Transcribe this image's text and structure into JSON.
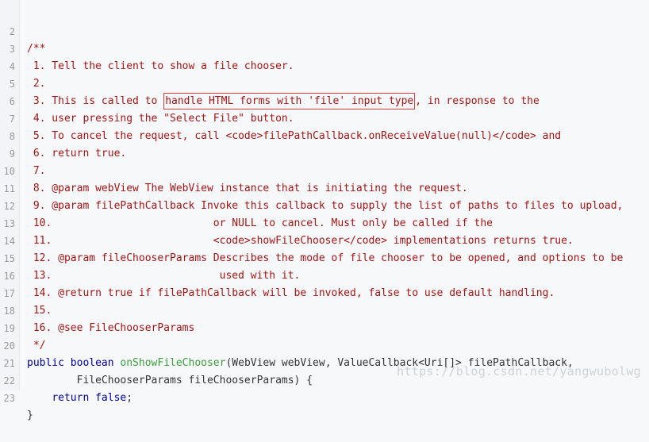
{
  "code_lines": [
    {
      "num": "2",
      "text": "/**"
    },
    {
      "num": "3",
      "text": " 1. Tell the client to show a file chooser."
    },
    {
      "num": "4",
      "text": " 2."
    },
    {
      "num": "5",
      "pre": " 3. This is called to ",
      "highlight": "handle HTML forms with 'file' input type",
      "post": ", in response to the"
    },
    {
      "num": "6",
      "text": " 4. user pressing the \"Select File\" button."
    },
    {
      "num": "7",
      "text": " 5. To cancel the request, call <code>filePathCallback.onReceiveValue(null)</code> and"
    },
    {
      "num": "8",
      "text": " 6. return true."
    },
    {
      "num": "9",
      "text": " 7."
    },
    {
      "num": "10",
      "text": " 8. @param webView The WebView instance that is initiating the request."
    },
    {
      "num": "11",
      "text": " 9. @param filePathCallback Invoke this callback to supply the list of paths to files to upload,"
    },
    {
      "num": "12",
      "text": " 10.                          or NULL to cancel. Must only be called if the"
    },
    {
      "num": "13",
      "text": " 11.                          <code>showFileChooser</code> implementations returns true."
    },
    {
      "num": "14",
      "text": " 12. @param fileChooserParams Describes the mode of file chooser to be opened, and options to be"
    },
    {
      "num": "15",
      "text": " 13.                           used with it."
    },
    {
      "num": "16",
      "text": " 14. @return true if filePathCallback will be invoked, false to use default handling."
    },
    {
      "num": "17",
      "text": " 15."
    },
    {
      "num": "18",
      "text": " 16. @see FileChooserParams"
    },
    {
      "num": "19",
      "text": " */"
    },
    {
      "num": "20",
      "kw1": "public boolean ",
      "fn": "onShowFileChooser",
      "rest": "(WebView webView, ValueCallback<Uri[]> filePathCallback,"
    },
    {
      "num": "21",
      "text": "        FileChooserParams fileChooserParams) {"
    },
    {
      "num": "22",
      "indent": "    ",
      "kw": "return false",
      "rest": ";"
    },
    {
      "num": "23",
      "text": "}"
    }
  ],
  "watermark": "https://blog.csdn.net/yangwubolwg",
  "colors": {
    "comment": "#a31515",
    "keyword": "#0000a0",
    "method": "#3b9e3b",
    "highlight_box": "#e23b3b",
    "background": "#f6f8fa"
  }
}
